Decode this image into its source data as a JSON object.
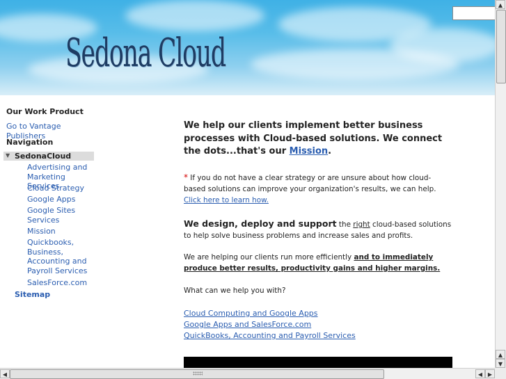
{
  "header": {
    "site_title": "Sedona Cloud"
  },
  "search": {
    "placeholder": ""
  },
  "sidebar": {
    "work_heading": "Our Work Product",
    "work_link": "Go to Vantage Publishers",
    "nav_heading": "Navigation",
    "current": "SedonaCloud",
    "items": [
      {
        "label": "Advertising and Marketing Services"
      },
      {
        "label": "Cloud Strategy"
      },
      {
        "label": "Google Apps"
      },
      {
        "label": "Google Sites Services"
      },
      {
        "label": "Mission"
      },
      {
        "label": "Quickbooks, Business, Accounting and Payroll Services"
      },
      {
        "label": "SalesForce.com"
      }
    ],
    "sitemap": "Sitemap"
  },
  "content": {
    "lead_text": "We help our clients implement better business processes with Cloud-based solutions. We connect the dots...that's our ",
    "lead_link": "Mission",
    "lead_end": ".",
    "note_star": "*",
    "note_text": " If you do not have a clear strategy or are unsure about how cloud-based solutions can improve your organization's results, we can help. ",
    "note_link": "Click here to learn how.",
    "design_bold": "We design, deploy and support",
    "design_mid1": " the ",
    "design_right": "right",
    "design_mid2": " cloud-based solutions to help solve business problems and increase sales and profits.",
    "helping_text": "We are helping our clients run more efficiently ",
    "helping_bold": "and to immediately produce better results, productivity gains and higher margins.",
    "question": "What can we help you with?",
    "links": [
      "Cloud Computing and Google Apps ",
      "Google Apps and SalesForce.com",
      "QuickBooks, Accounting and Payroll Services"
    ]
  },
  "scrollbars": {
    "up_arrow_icon": "▲",
    "down_arrow_icon": "▼",
    "left_arrow_icon": "◀",
    "right_arrow_icon": "▶"
  },
  "colors": {
    "link": "#2a5db0",
    "banner_sky": "#3fb1e6",
    "title_text": "#1d3c63",
    "asterisk": "#d40000"
  }
}
